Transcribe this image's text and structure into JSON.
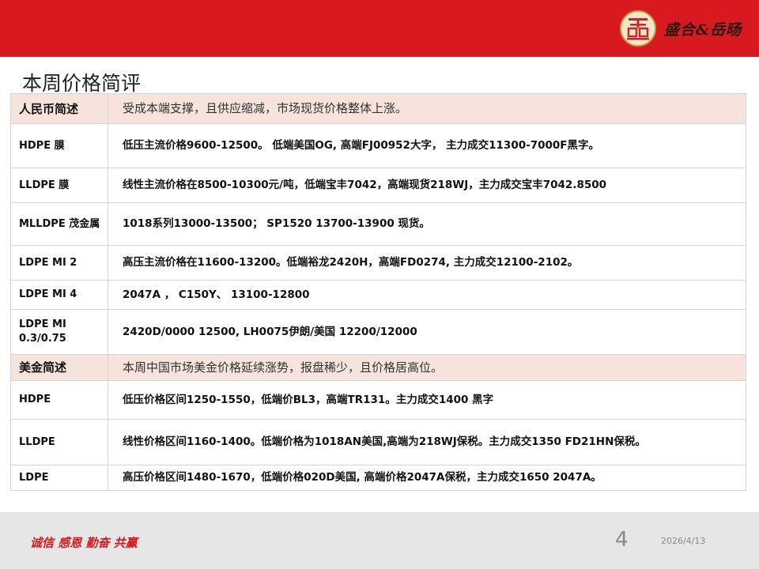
{
  "header": {
    "logo_text": "盛合&岳旸"
  },
  "title": "本周价格简评",
  "rows": [
    {
      "label": "人民币简述",
      "content": "受成本端支撑，且供应缩减，市场现货价格整体上涨。"
    },
    {
      "label": "HDPE 膜",
      "content": "低压主流价格9600-12500。 低端美国OG, 高端FJ00952大字， 主力成交11300-7000F黑字。"
    },
    {
      "label": "LLDPE 膜",
      "content": "线性主流价格在8500-10300元/吨，低端宝丰7042，高端现货218WJ，主力成交宝丰7042.8500"
    },
    {
      "label": "MLLDPE 茂金属",
      "content": "1018系列13000-13500； SP1520  13700-13900 现货。"
    },
    {
      "label": "LDPE MI 2",
      "content": "高压主流价格在11600-13200。低端裕龙2420H，高端FD0274, 主力成交12100-2102。"
    },
    {
      "label": "LDPE MI 4",
      "content": "2047A ， C150Y、 13100-12800"
    },
    {
      "label": "LDPE MI 0.3/0.75",
      "content": "2420D/0000  12500, LH0075伊朗/美国  12200/12000"
    },
    {
      "label": "美金简述",
      "content": "本周中国市场美金价格延续涨势，报盘稀少，且价格居高位。"
    },
    {
      "label": "HDPE",
      "content": "低压价格区间1250-1550，低端价BL3，高端TR131。主力成交1400 黑字"
    },
    {
      "label": "LLDPE",
      "content": "线性价格区间1160-1400。低端价格为1018AN美国,高端为218WJ保税。主力成交1350  FD21HN保税。"
    },
    {
      "label": "LDPE",
      "content": "高压价格区间1480-1670，低端价格020D美国, 高端价格2047A保税，主力成交1650  2047A。"
    }
  ],
  "footer": {
    "slogan": "诚信 感恩 勤奋 共赢",
    "page_number": "4",
    "date": "2026/4/13"
  },
  "colors": {
    "brand_red": "#d71920",
    "highlight_row": "#f6e3dc"
  }
}
